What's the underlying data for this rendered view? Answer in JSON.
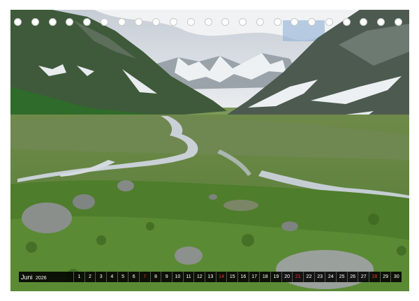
{
  "calendar": {
    "month": "Juni",
    "year": "2026",
    "days": [
      "1",
      "2",
      "3",
      "4",
      "5",
      "6",
      "7",
      "8",
      "9",
      "10",
      "11",
      "12",
      "13",
      "14",
      "15",
      "16",
      "17",
      "18",
      "19",
      "20",
      "21",
      "22",
      "23",
      "24",
      "25",
      "26",
      "27",
      "28",
      "29",
      "30"
    ],
    "sundays": [
      "7",
      "14",
      "21",
      "28"
    ],
    "hole_count": 23
  },
  "colors": {
    "sunday": "#e53935",
    "strip": "#111111"
  }
}
